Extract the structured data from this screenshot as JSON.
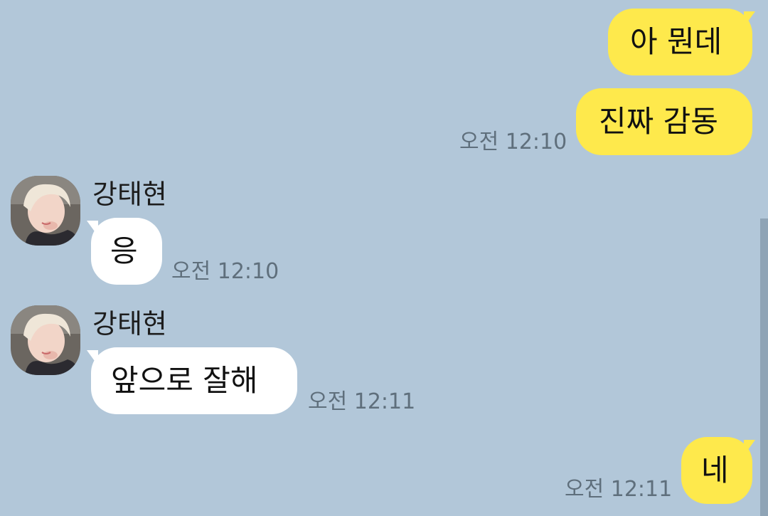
{
  "messages": [
    {
      "side": "me",
      "text": "아 뭔데"
    },
    {
      "side": "me",
      "text": "진짜 감동",
      "time": "오전 12:10"
    },
    {
      "side": "them",
      "sender": "강태현",
      "text": "응",
      "time": "오전 12:10"
    },
    {
      "side": "them",
      "sender": "강태현",
      "text": "앞으로 잘해",
      "time": "오전 12:11"
    },
    {
      "side": "me",
      "text": "네",
      "time": "오전 12:11"
    }
  ],
  "colors": {
    "background": "#b2c7d9",
    "my_bubble": "#fee94c",
    "their_bubble": "#ffffff",
    "timestamp": "#5f6f7c"
  },
  "icons": {
    "avatar": "profile-photo"
  }
}
